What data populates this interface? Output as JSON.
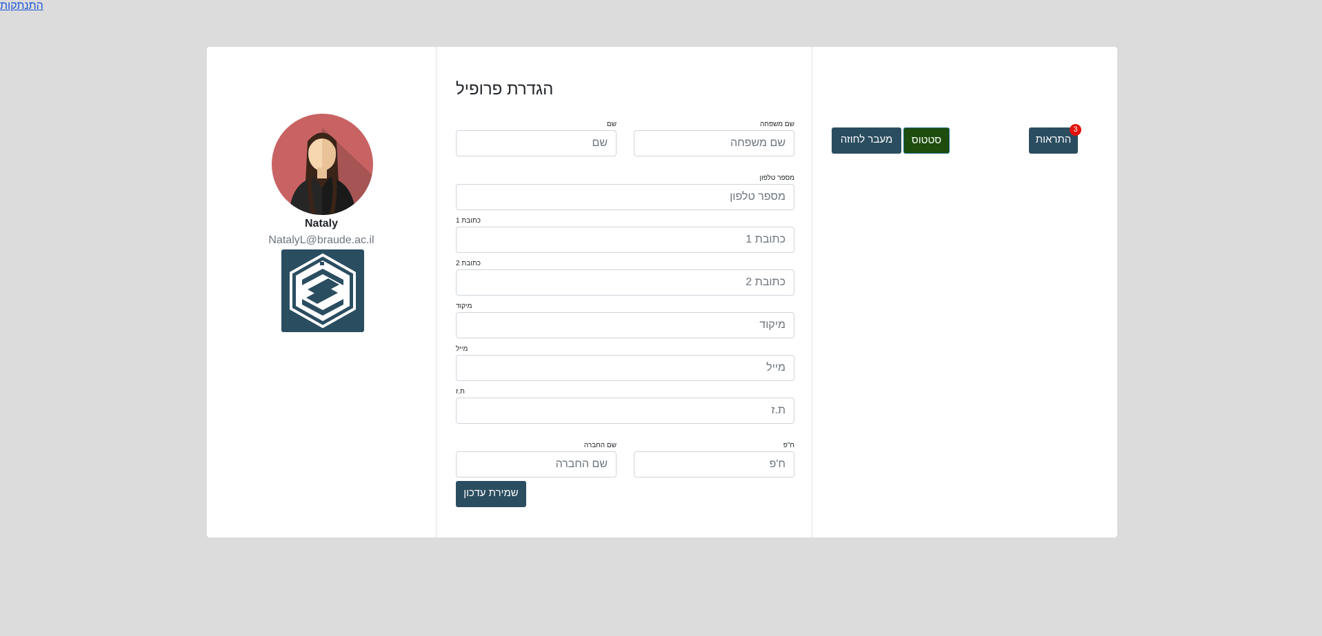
{
  "header": {
    "logout_label": "התנתקות"
  },
  "profile": {
    "name": "Nataly",
    "email": "NatalyL@braude.ac.il"
  },
  "form": {
    "title": "הגדרת פרופיל",
    "first_name": {
      "label": "שם",
      "placeholder": "שם"
    },
    "last_name": {
      "label": "שם משפחה",
      "placeholder": "שם משפחה"
    },
    "phone": {
      "label": "מספר טלפון",
      "placeholder": "מספר טלפון"
    },
    "address1": {
      "label": "כתובת 1",
      "placeholder": "כתובת 1"
    },
    "address2": {
      "label": "כתובת 2",
      "placeholder": "כתובת 2"
    },
    "zip": {
      "label": "מיקוד",
      "placeholder": "מיקוד"
    },
    "email": {
      "label": "מייל",
      "placeholder": "מייל"
    },
    "id_number": {
      "label": "ת.ז",
      "placeholder": "ת.ז"
    },
    "company_name": {
      "label": "שם החברה",
      "placeholder": "שם החברה"
    },
    "company_id": {
      "label": "ח\"פ",
      "placeholder": "ח'פ"
    },
    "save_label": "שמירת עדכון"
  },
  "actions": {
    "contract_label": "מעבר לחוזה",
    "status_label": "סטטוס",
    "alerts_label": "התראות",
    "alerts_count": "3"
  },
  "colors": {
    "background": "#dcdcdc",
    "primary": "#2b4d60",
    "status": "#1e4d0f",
    "badge": "#e3120b",
    "link": "#1a55d6"
  }
}
